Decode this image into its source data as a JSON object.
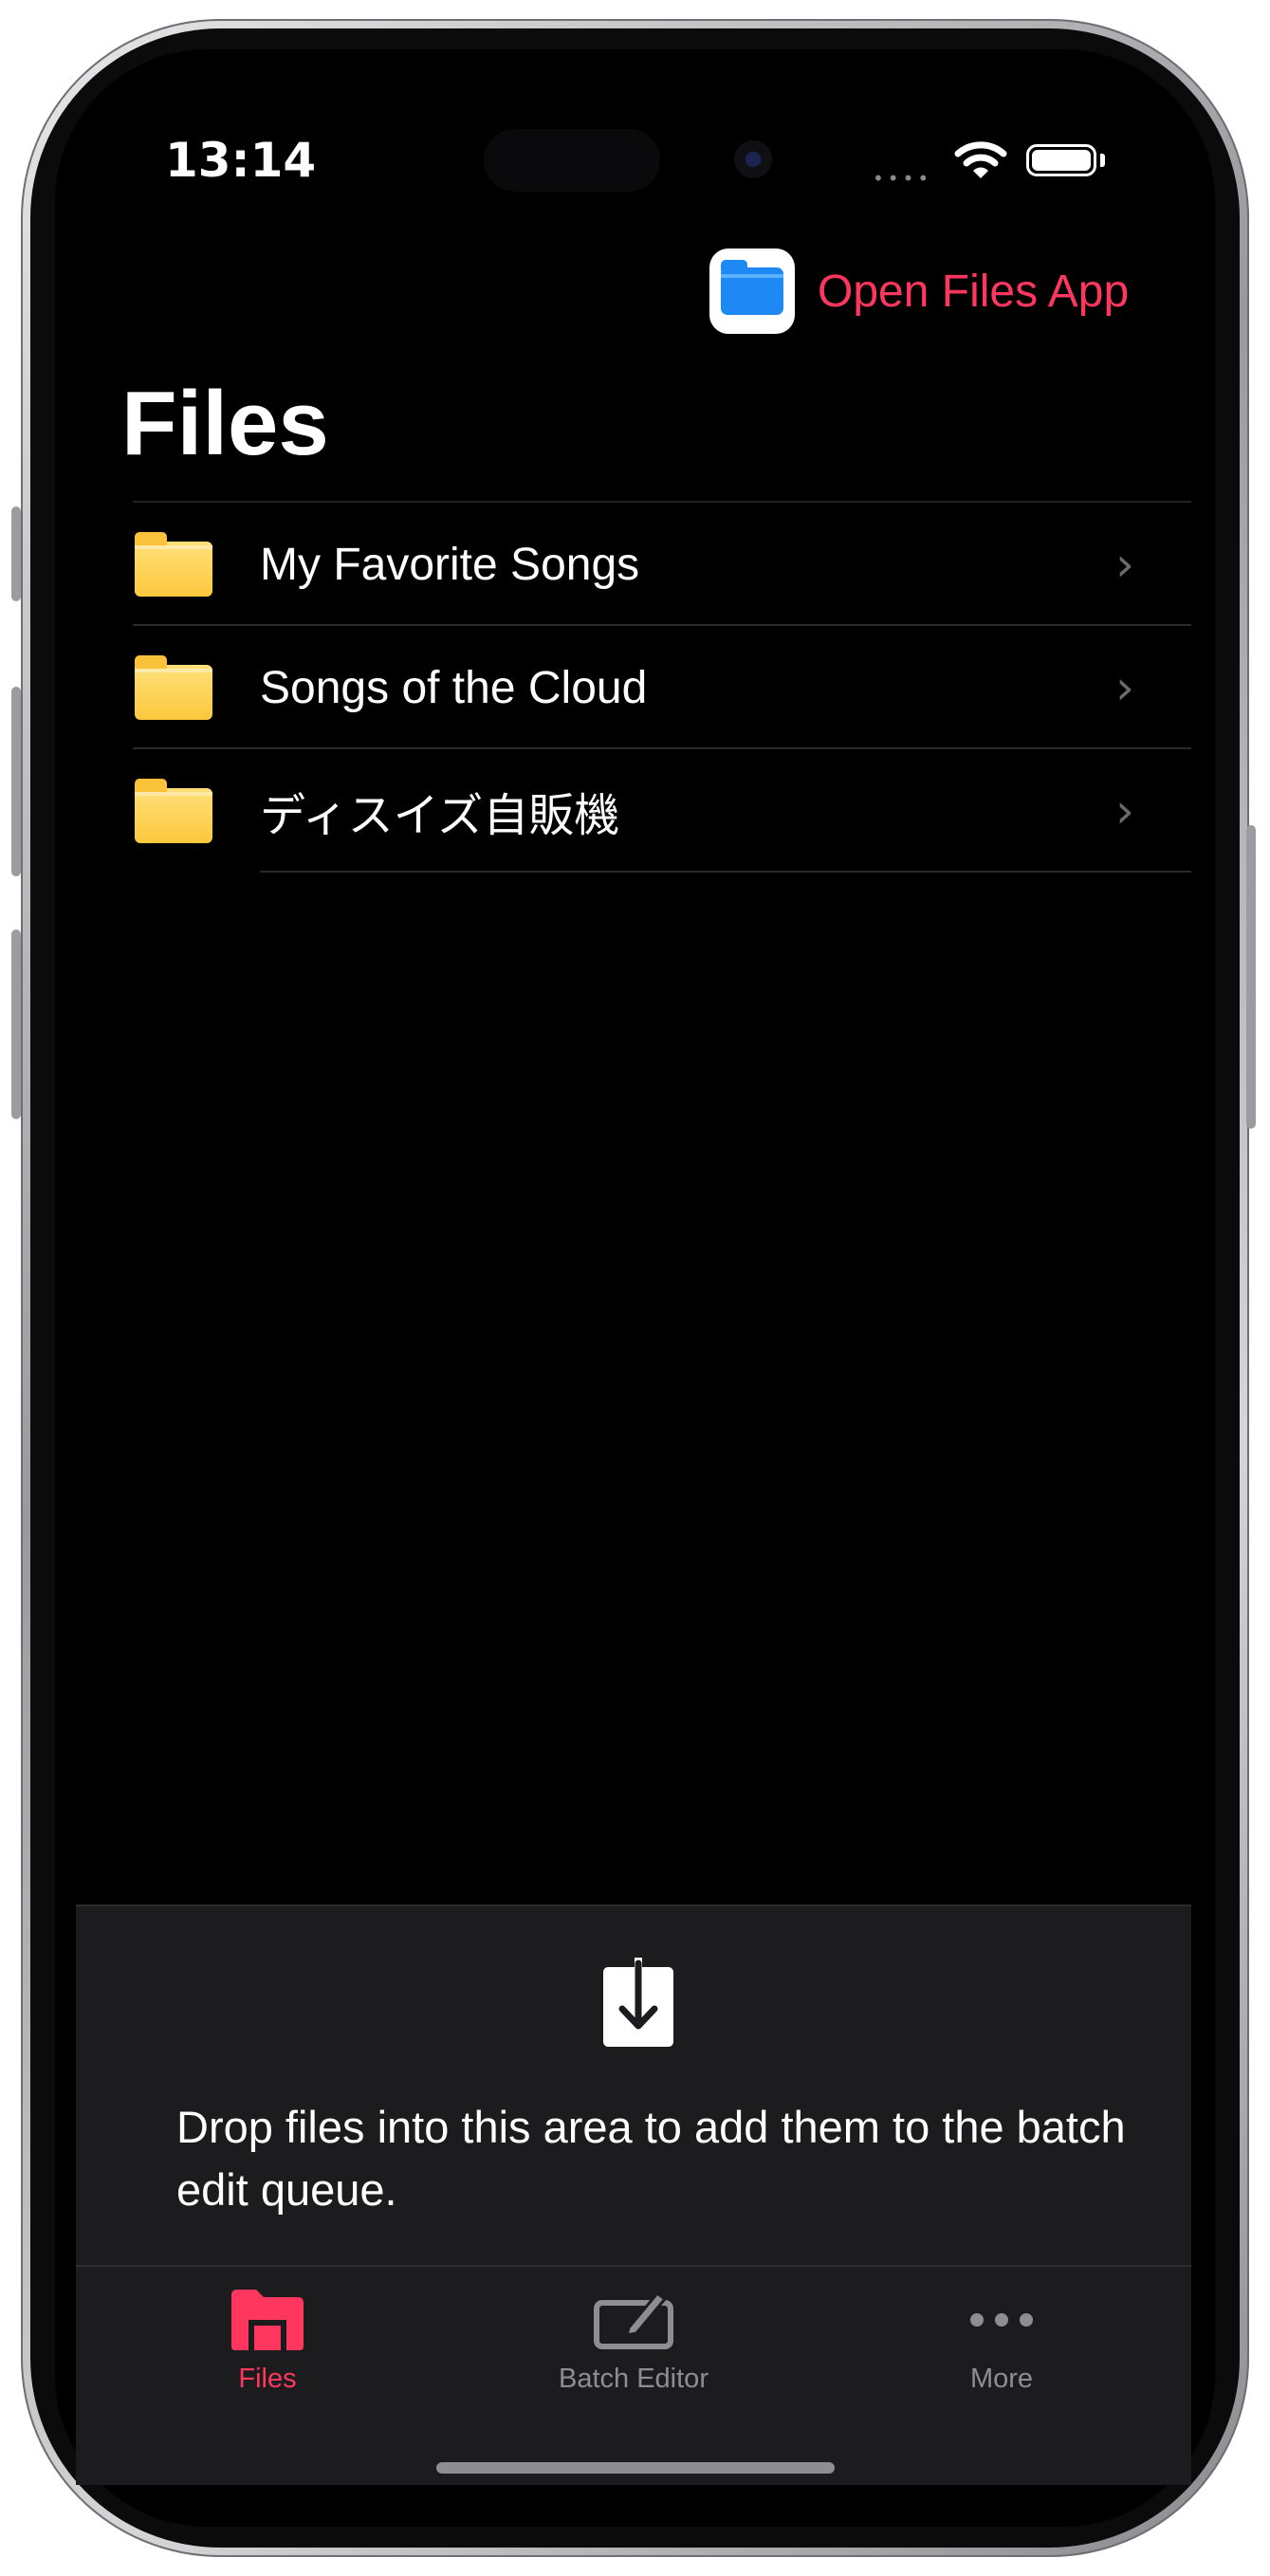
{
  "status_bar": {
    "time": "13:14",
    "signal_dots": "••••"
  },
  "header": {
    "open_files_label": "Open Files App",
    "title": "Files"
  },
  "folders": [
    {
      "label": "My Favorite Songs"
    },
    {
      "label": "Songs of the Cloud"
    },
    {
      "label": "ディスイズ自販機"
    }
  ],
  "dropzone": {
    "text": "Drop files into this area to add them to the batch edit queue."
  },
  "tabs": [
    {
      "label": "Files",
      "active": true
    },
    {
      "label": "Batch Editor",
      "active": false
    },
    {
      "label": "More",
      "active": false
    }
  ],
  "colors": {
    "accent": "#ff375f",
    "background": "#000000",
    "panel": "#1c1c1e",
    "inactive": "#8e8e92",
    "folder": "#fcc83d"
  },
  "icons": [
    "files-app-icon",
    "folder-icon",
    "chevron-right-icon",
    "download-tray-icon",
    "files-tab-icon",
    "batch-editor-icon",
    "more-icon",
    "wifi-icon",
    "battery-icon"
  ]
}
